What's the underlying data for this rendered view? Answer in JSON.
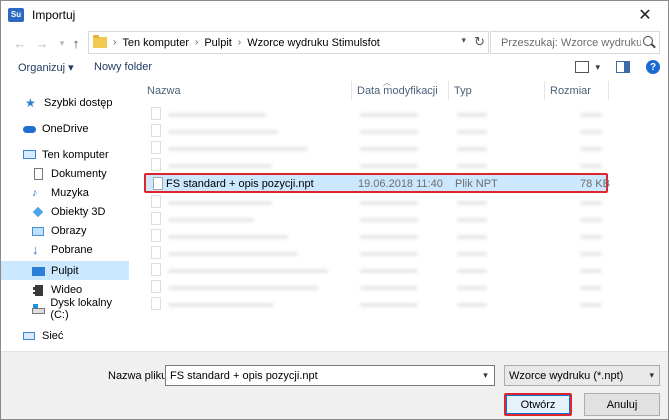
{
  "window": {
    "title": "Importuj",
    "app_icon_text": "Su"
  },
  "address": {
    "crumbs": [
      "Ten komputer",
      "Pulpit",
      "Wzorce wydruku Stimulsfot"
    ],
    "search_placeholder": "Przeszukaj: Wzorce wydruku S..."
  },
  "toolbar": {
    "organize_label": "Organizuj ▾",
    "new_folder_label": "Nowy folder"
  },
  "nav": {
    "items": [
      {
        "label": "Szybki dostęp",
        "icon": "star-icon"
      },
      {
        "label": "OneDrive",
        "icon": "cloud-icon"
      },
      {
        "label": "Ten komputer",
        "icon": "computer-icon"
      },
      {
        "label": "Dokumenty",
        "icon": "documents-icon"
      },
      {
        "label": "Muzyka",
        "icon": "music-icon"
      },
      {
        "label": "Obiekty 3D",
        "icon": "3d-objects-icon"
      },
      {
        "label": "Obrazy",
        "icon": "pictures-icon"
      },
      {
        "label": "Pobrane",
        "icon": "download-icon"
      },
      {
        "label": "Pulpit",
        "icon": "desktop-icon"
      },
      {
        "label": "Wideo",
        "icon": "video-icon"
      },
      {
        "label": "Dysk lokalny (C:)",
        "icon": "drive-icon"
      },
      {
        "label": "Sieć",
        "icon": "network-icon"
      }
    ]
  },
  "columns": {
    "name": "Nazwa",
    "modified": "Data modyfikacji",
    "type": "Typ",
    "size": "Rozmiar"
  },
  "files": {
    "selected": {
      "name": "FS standard + opis pozycji.npt",
      "modified": "19.06.2018 11:40",
      "type": "Plik NPT",
      "size": "78 KB"
    }
  },
  "bottom": {
    "filename_label": "Nazwa pliku:",
    "filename_value": "FS standard + opis pozycji.npt",
    "filetype_value": "Wzorce wydruku (*.npt)",
    "open_label": "Otwórz",
    "cancel_label": "Anuluj"
  },
  "colors": {
    "selection_bg": "#cce8ff",
    "highlight_red": "#e0242d",
    "accent_blue": "#0078d7"
  }
}
